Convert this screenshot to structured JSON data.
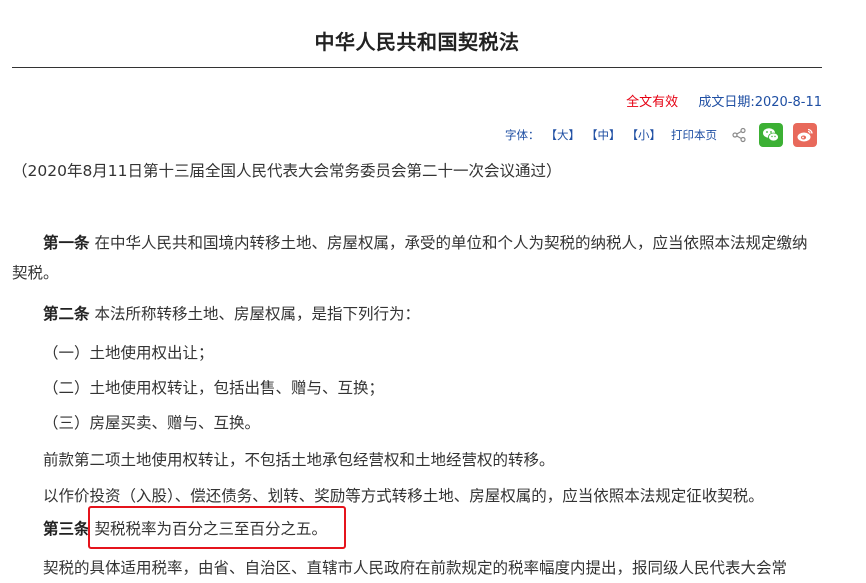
{
  "document": {
    "title": "中华人民共和国契税法",
    "validity": "全文有效",
    "date_label": "成文日期:",
    "date_value": "2020-8-11"
  },
  "toolbar": {
    "font_label": "字体：",
    "size_large": "【大】",
    "size_medium": "【中】",
    "size_small": "【小】",
    "print_label": "打印本页",
    "icons": [
      "share-icon",
      "wechat-icon",
      "weibo-icon"
    ],
    "wechat_color": "#3cb034",
    "weibo_color": "#e8695b"
  },
  "content": {
    "preamble": "（2020年8月11日第十三届全国人民代表大会常务委员会第二十一次会议通过）",
    "article1_label": "第一条",
    "article1_text": "在中华人民共和国境内转移土地、房屋权属，承受的单位和个人为契税的纳税人，应当依照本法规定缴纳契税。",
    "article2_label": "第二条",
    "article2_text": "本法所称转移土地、房屋权属，是指下列行为：",
    "item1": "（一）土地使用权出让；",
    "item2": "（二）土地使用权转让，包括出售、赠与、互换；",
    "item3": "（三）房屋买卖、赠与、互换。",
    "note1": "前款第二项土地使用权转让，不包括土地承包经营权和土地经营权的转移。",
    "note2": "以作价投资（入股）、偿还债务、划转、奖励等方式转移土地、房屋权属的，应当依照本法规定征收契税。",
    "article3_label": "第三条",
    "article3_text": "契税税率为百分之三至百分之五。",
    "paragraph_last": "契税的具体适用税率，由省、自治区、直辖市人民政府在前款规定的税率幅度内提出，报同级人民代表大会常"
  },
  "colors": {
    "validity": "#e60012",
    "link": "#1f4fa3",
    "highlight_border": "#e5141c"
  }
}
